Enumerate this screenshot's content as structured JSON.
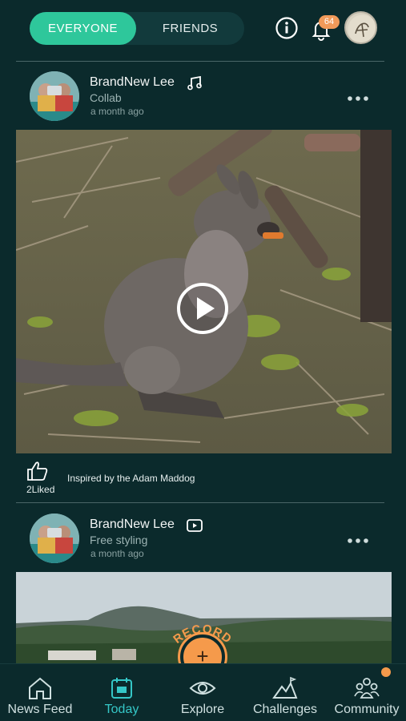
{
  "tabs": {
    "everyone": "EVERYONE",
    "friends": "FRIENDS"
  },
  "header": {
    "notification_count": "64"
  },
  "posts": [
    {
      "author": "BrandNew Lee",
      "subtitle": "Collab",
      "time": "a month ago",
      "type_icon": "music-note-icon",
      "likes": "2Liked",
      "inspired": "Inspired by the Adam Maddog"
    },
    {
      "author": "BrandNew Lee",
      "subtitle": "Free styling",
      "time": "a month ago",
      "type_icon": "video-icon"
    }
  ],
  "record": {
    "label": "RECORD"
  },
  "nav": {
    "items": [
      {
        "label": "News Feed",
        "icon": "home-icon"
      },
      {
        "label": "Today",
        "icon": "calendar-icon"
      },
      {
        "label": "Explore",
        "icon": "eye-icon"
      },
      {
        "label": "Challenges",
        "icon": "mountain-icon"
      },
      {
        "label": "Community",
        "icon": "people-icon"
      }
    ],
    "active": "Today"
  },
  "colors": {
    "accent": "#2ec79b",
    "background": "#0b2a2c",
    "record": "#f59a4b",
    "active_tab": "#35c7c7"
  }
}
